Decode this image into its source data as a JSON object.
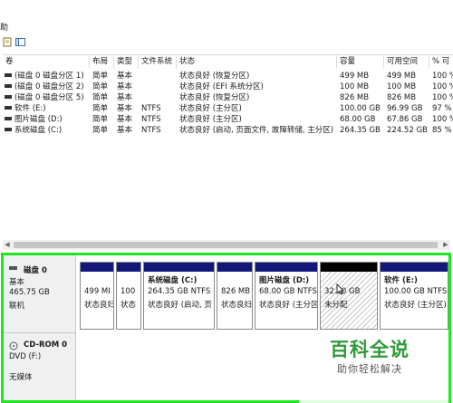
{
  "menu": {
    "action_label": "助"
  },
  "table": {
    "columns": [
      "卷",
      "布局",
      "类型",
      "文件系统",
      "状态",
      "容量",
      "可用空间",
      "% 可"
    ],
    "rows": [
      {
        "volume": "(磁盘 0 磁盘分区 1)",
        "layout": "简单",
        "type": "基本",
        "fs": "",
        "status": "状态良好 (恢复分区)",
        "capacity": "499 MB",
        "free": "499 MB",
        "pct": "100 %"
      },
      {
        "volume": "(磁盘 0 磁盘分区 2)",
        "layout": "简单",
        "type": "基本",
        "fs": "",
        "status": "状态良好 (EFI 系统分区)",
        "capacity": "100 MB",
        "free": "100 MB",
        "pct": "100 %"
      },
      {
        "volume": "(磁盘 0 磁盘分区 5)",
        "layout": "简单",
        "type": "基本",
        "fs": "",
        "status": "状态良好 (恢复分区)",
        "capacity": "826 MB",
        "free": "826 MB",
        "pct": "100 %"
      },
      {
        "volume": "软件 (E:)",
        "layout": "简单",
        "type": "基本",
        "fs": "NTFS",
        "status": "状态良好 (主分区)",
        "capacity": "100.00 GB",
        "free": "96.99 GB",
        "pct": "97 %"
      },
      {
        "volume": "图片磁盘 (D:)",
        "layout": "简单",
        "type": "基本",
        "fs": "NTFS",
        "status": "状态良好 (主分区)",
        "capacity": "68.00 GB",
        "free": "67.86 GB",
        "pct": "100 %"
      },
      {
        "volume": "系统磁盘 (C:)",
        "layout": "简单",
        "type": "基本",
        "fs": "NTFS",
        "status": "状态良好 (启动, 页面文件, 故障转储, 主分区)",
        "capacity": "264.35 GB",
        "free": "224.52 GB",
        "pct": "85 %"
      }
    ]
  },
  "disk0": {
    "name": "磁盘 0",
    "type": "基本",
    "size": "465.75 GB",
    "state": "联机",
    "partitions": [
      {
        "line1": "499 MI",
        "line2": "状态良妇"
      },
      {
        "line1": "100",
        "line2": "状态"
      },
      {
        "title": "系统磁盘  (C:)",
        "line1": "264.35 GB NTFS",
        "line2": "状态良好 (启动, 页"
      },
      {
        "line1": "826 MB",
        "line2": "状态良妇"
      },
      {
        "title": "图片磁盘  (D:)",
        "line1": "68.00 GB NTFS",
        "line2": "状态良好 (主分区)"
      },
      {
        "line1": "32.00 GB",
        "line2": "未分配"
      },
      {
        "title": "软件  (E:)",
        "line1": "100.00 GB NTFS",
        "line2": "状态良好 (主分区)"
      }
    ]
  },
  "cdrom": {
    "name": "CD-ROM 0",
    "drive": "DVD (F:)",
    "media": "无媒体"
  },
  "watermark": {
    "title": "百科全说",
    "subtitle": "助你轻松解决"
  },
  "colors": {
    "partition_bar": "#14177a",
    "unallocated_bar": "#000000",
    "highlight_box": "#1fe61f",
    "watermark": "#2f9a3a"
  }
}
